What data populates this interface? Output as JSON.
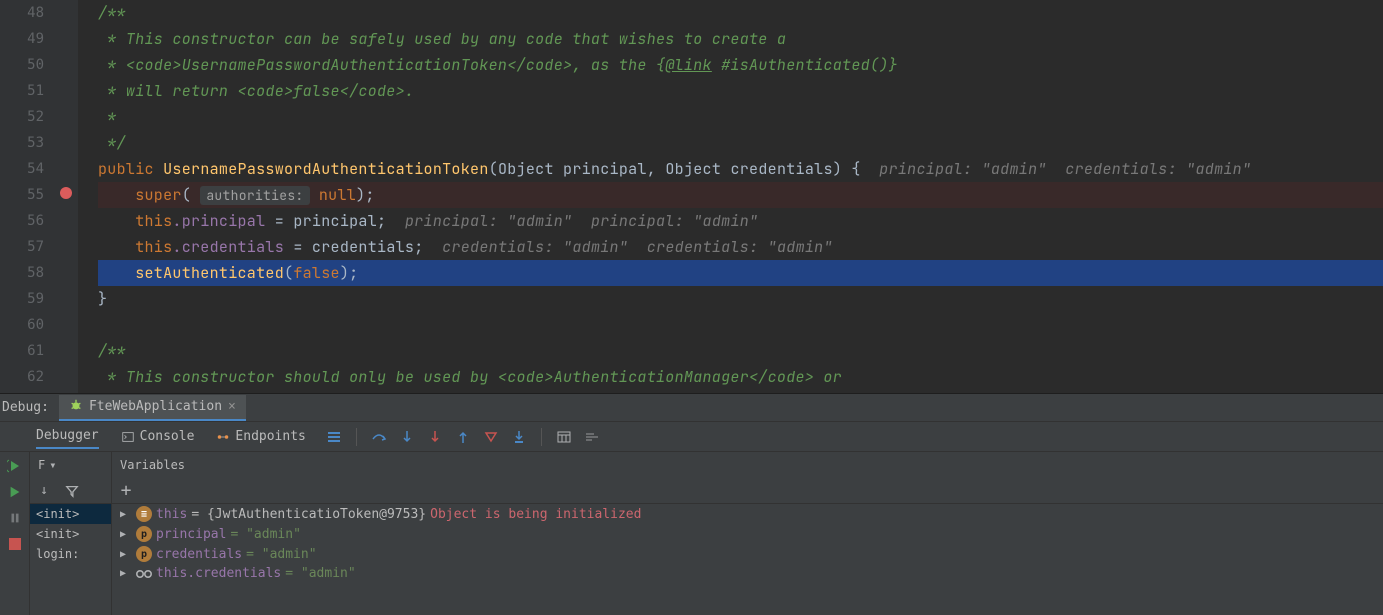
{
  "gutter": {
    "lines": [
      "48",
      "49",
      "50",
      "51",
      "52",
      "53",
      "54",
      "55",
      "56",
      "57",
      "58",
      "59",
      "60",
      "61",
      "62"
    ]
  },
  "code": {
    "l48": "/**",
    "l49": " * This constructor can be safely used by any code that wishes to create a",
    "l50_a": " * <code>UsernamePasswordAuthenticationToken</code>, as the {",
    "l50_link": "@link",
    "l50_b": " #isAuthenticated()}",
    "l51": " * will return <code>false</code>.",
    "l52": " *",
    "l53": " */",
    "l54_public": "public",
    "l54_name": "UsernamePasswordAuthenticationToken",
    "l54_sig": "(Object principal, Object credentials) {",
    "l54_hint1": "principal: \"admin\"",
    "l54_hint2": "credentials: \"admin\"",
    "l55_super": "super",
    "l55_hint": "authorities:",
    "l55_null": "null",
    "l56_this": "this",
    "l56_field": ".principal",
    "l56_rest": " = principal;",
    "l56_hint1": "principal: \"admin\"",
    "l56_hint2": "principal: \"admin\"",
    "l57_this": "this",
    "l57_field": ".credentials",
    "l57_rest": " = credentials;",
    "l57_hint1": "credentials: \"admin\"",
    "l57_hint2": "credentials: \"admin\"",
    "l58_call": "setAuthenticated",
    "l58_false": "false",
    "l59": "}",
    "l61": "/**",
    "l62_a": " * This constructor should only be used by ",
    "l62_b": "<code>AuthenticationManager</code>",
    "l62_c": " or"
  },
  "debug": {
    "label": "Debug:",
    "tab_name": "FteWebApplication",
    "tabs": {
      "debugger": "Debugger",
      "console": "Console",
      "endpoints": "Endpoints"
    },
    "frames_label": "F",
    "vars_label": "Variables",
    "frames": [
      "<init>",
      "<init>",
      "login:"
    ],
    "vars": {
      "this_name": "this",
      "this_val": " = {JwtAuthenticatioToken@9753}",
      "this_warn": "Object is being initialized",
      "principal_name": "principal",
      "principal_val": " = \"admin\"",
      "credentials_name": "credentials",
      "credentials_val": " = \"admin\"",
      "this_cred_name": "this.credentials",
      "this_cred_val": " = \"admin\""
    }
  }
}
